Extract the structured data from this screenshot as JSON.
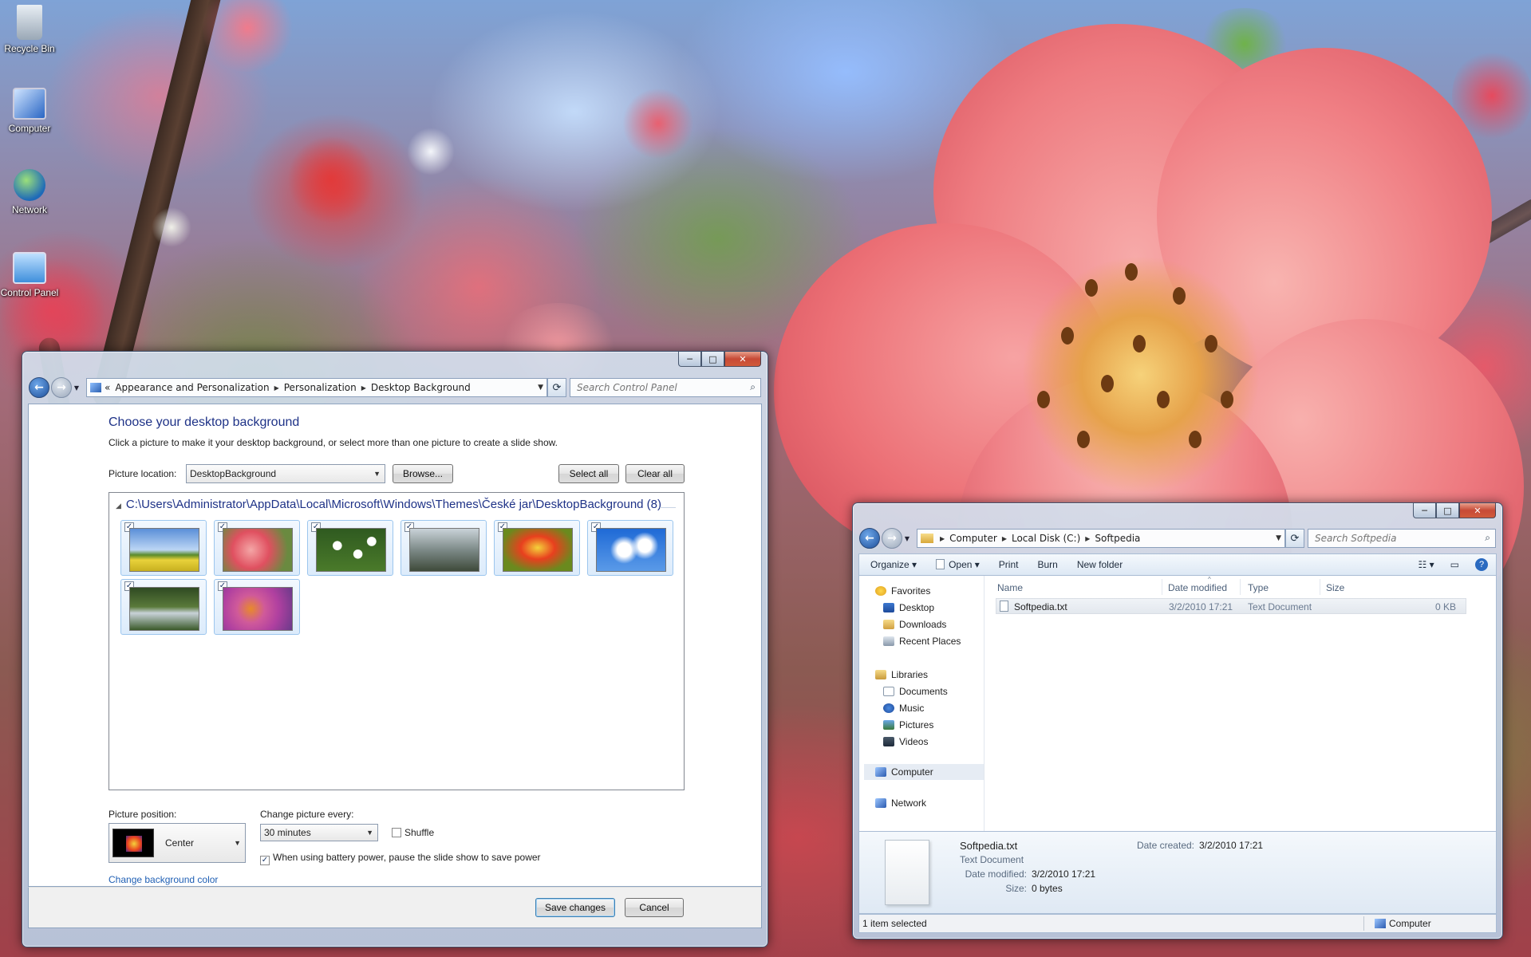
{
  "desktop": {
    "icons": [
      {
        "label": "Recycle Bin"
      },
      {
        "label": "Computer"
      },
      {
        "label": "Network"
      },
      {
        "label": "Control Panel"
      }
    ]
  },
  "control_panel": {
    "breadcrumb": [
      "Appearance and Personalization",
      "Personalization",
      "Desktop Background"
    ],
    "search_placeholder": "Search Control Panel",
    "title": "Choose your desktop background",
    "description": "Click a picture to make it your desktop background, or select more than one picture to create a slide show.",
    "picture_location_label": "Picture location:",
    "picture_location_value": "DesktopBackground",
    "browse_label": "Browse...",
    "select_all_label": "Select all",
    "clear_all_label": "Clear all",
    "group_header": "C:\\Users\\Administrator\\AppData\\Local\\Microsoft\\Windows\\Themes\\České jar\\DesktopBackground (8)",
    "check_mark": "✓",
    "thumbnails": [
      {
        "subject": "field-meadow",
        "checked": true
      },
      {
        "subject": "pink-blossom",
        "checked": true
      },
      {
        "subject": "daisies",
        "checked": true
      },
      {
        "subject": "misty-landscape",
        "checked": true
      },
      {
        "subject": "red-tulip",
        "checked": true
      },
      {
        "subject": "white-blossom-sky",
        "checked": true
      },
      {
        "subject": "forest-stream",
        "checked": true
      },
      {
        "subject": "butterfly-flowers",
        "checked": true
      }
    ],
    "picture_position_label": "Picture position:",
    "picture_position_value": "Center",
    "change_picture_label": "Change picture every:",
    "change_picture_value": "30 minutes",
    "shuffle_label": "Shuffle",
    "shuffle_checked": false,
    "battery_label": "When using battery power, pause the slide show to save power",
    "battery_checked": true,
    "change_color_link": "Change background color",
    "save_label": "Save changes",
    "cancel_label": "Cancel"
  },
  "explorer": {
    "breadcrumb": [
      "Computer",
      "Local Disk (C:)",
      "Softpedia"
    ],
    "search_placeholder": "Search Softpedia",
    "toolbar": {
      "organize": "Organize",
      "open": "Open",
      "print": "Print",
      "burn": "Burn",
      "new_folder": "New folder"
    },
    "nav": {
      "favorites": "Favorites",
      "desktop": "Desktop",
      "downloads": "Downloads",
      "recent": "Recent Places",
      "libraries": "Libraries",
      "documents": "Documents",
      "music": "Music",
      "pictures": "Pictures",
      "videos": "Videos",
      "computer": "Computer",
      "network": "Network"
    },
    "columns": {
      "name": "Name",
      "date": "Date modified",
      "type": "Type",
      "size": "Size"
    },
    "files": [
      {
        "name": "Softpedia.txt",
        "date": "3/2/2010 17:21",
        "type": "Text Document",
        "size": "0 KB"
      }
    ],
    "details": {
      "name": "Softpedia.txt",
      "type": "Text Document",
      "modified_label": "Date modified:",
      "modified_value": "3/2/2010 17:21",
      "size_label": "Size:",
      "size_value": "0 bytes",
      "created_label": "Date created:",
      "created_value": "3/2/2010 17:21"
    },
    "status_left": "1 item selected",
    "status_right": "Computer"
  },
  "caption": {
    "minimize": "─",
    "maximize": "□",
    "close": "✕"
  }
}
